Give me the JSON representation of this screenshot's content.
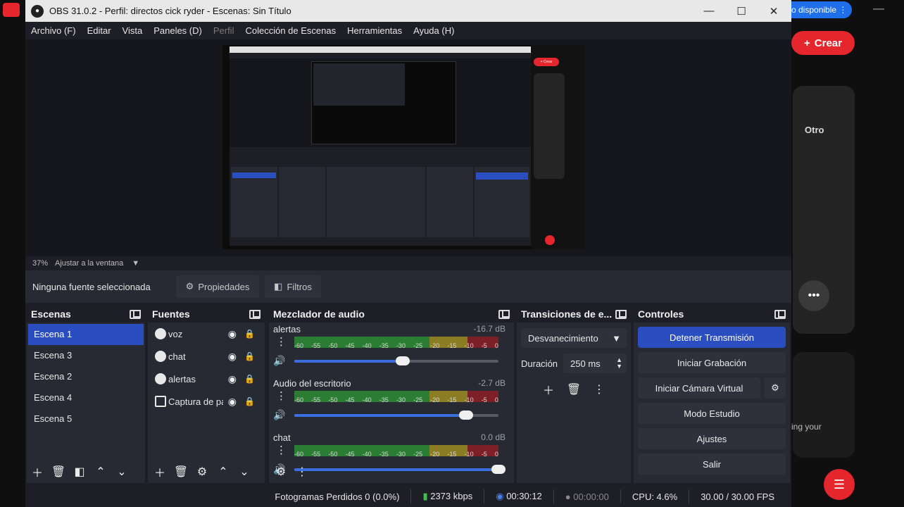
{
  "background": {
    "banner_text": "o disponible",
    "create_label": "Crear",
    "card_label": "Otro",
    "side_text": "ing your"
  },
  "window": {
    "title": "OBS 31.0.2 - Perfil: directos cick ryder - Escenas: Sin Título"
  },
  "menu": [
    "Archivo (F)",
    "Editar",
    "Vista",
    "Paneles (D)",
    "Perfil",
    "Colección de Escenas",
    "Herramientas",
    "Ayuda (H)"
  ],
  "preview": {
    "zoom": "37%",
    "fit_label": "Ajustar a la ventana"
  },
  "source_toolbar": {
    "none_selected": "Ninguna fuente seleccionada",
    "properties": "Propiedades",
    "filters": "Filtros"
  },
  "scenes": {
    "title": "Escenas",
    "items": [
      "Escena 1",
      "Escena 3",
      "Escena 2",
      "Escena 4",
      "Escena 5"
    ]
  },
  "sources": {
    "title": "Fuentes",
    "items": [
      "voz",
      "chat",
      "alertas",
      "Captura de pantalla"
    ]
  },
  "mixer": {
    "title": "Mezclador de audio",
    "ticks": [
      "-60",
      "-55",
      "-50",
      "-45",
      "-40",
      "-35",
      "-30",
      "-25",
      "-20",
      "-15",
      "-10",
      "-5",
      "0"
    ],
    "channels": [
      {
        "name": "alertas",
        "db": "-16.7 dB",
        "volume": 0.53
      },
      {
        "name": "Audio del escritorio",
        "db": "-2.7 dB",
        "volume": 0.84
      },
      {
        "name": "chat",
        "db": "0.0 dB",
        "volume": 1.0
      }
    ]
  },
  "transitions": {
    "title": "Transiciones de e...",
    "type": "Desvanecimiento",
    "duration_label": "Duración",
    "duration_value": "250 ms"
  },
  "controls": {
    "title": "Controles",
    "stop_stream": "Detener Transmisión",
    "start_recording": "Iniciar Grabación",
    "start_virtual_cam": "Iniciar Cámara Virtual",
    "studio_mode": "Modo Estudio",
    "settings": "Ajustes",
    "exit": "Salir"
  },
  "status": {
    "dropped_frames": "Fotogramas Perdidos 0 (0.0%)",
    "bitrate": "2373 kbps",
    "stream_time": "00:30:12",
    "record_time": "00:00:00",
    "cpu": "CPU: 4.6%",
    "fps": "30.00 / 30.00 FPS"
  },
  "colors": {
    "accent": "#2a4dbf",
    "create_red": "#e5262d",
    "meter_green": "#2a7d33",
    "meter_yellow": "#8a7d24",
    "meter_red": "#7c1f26"
  }
}
